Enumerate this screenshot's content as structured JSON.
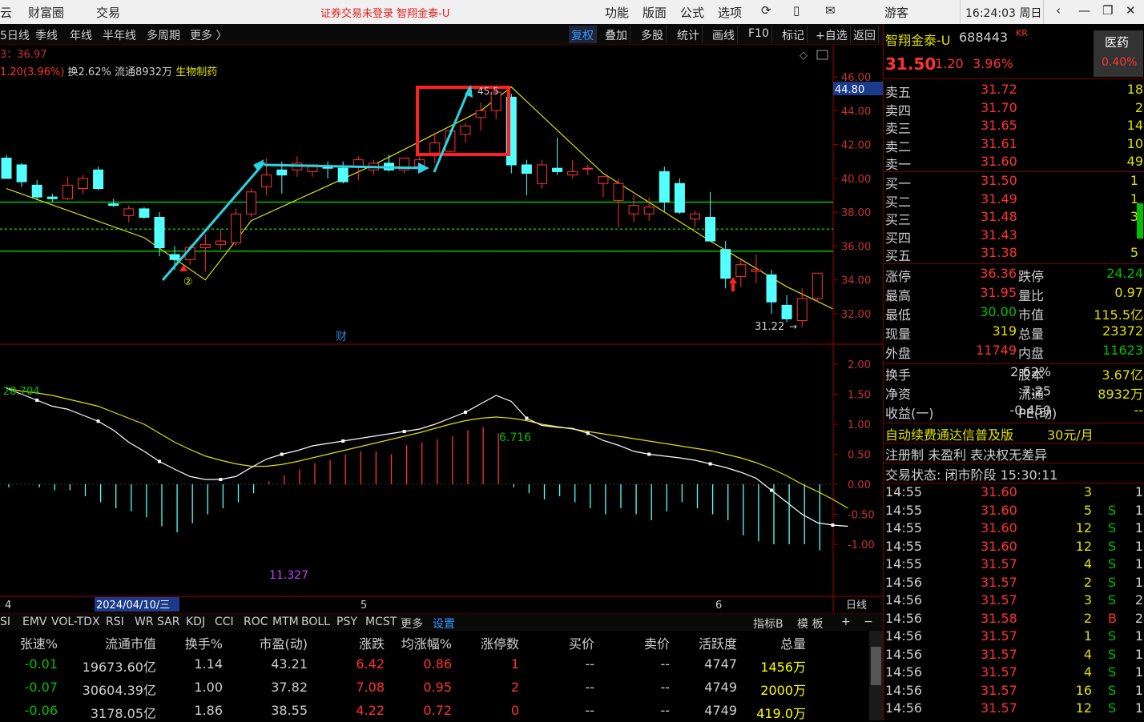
{
  "menu": {
    "items": [
      "云",
      "财富圈",
      "交易"
    ],
    "alert": "证券交易未登录  智翔金泰-U",
    "tools": [
      "功能",
      "版面",
      "公式",
      "选项"
    ],
    "user": "游客",
    "clock": "16:24:03 周日",
    "win": [
      "‹",
      "—",
      "❐",
      "✕"
    ]
  },
  "toolbar": {
    "periods": [
      "5日线",
      "季线",
      "年线",
      "半年线",
      "多周期",
      "更多 〉"
    ],
    "buttons": [
      "复权",
      "叠加",
      "多股",
      "统计",
      "画线",
      "F10",
      "标记",
      "+自选",
      "返回"
    ]
  },
  "info": {
    "line1": "3：36.97",
    "change": "1.20(3.96%)",
    "turnover": "换2.62% 流通8932万",
    "industry": "生物制药"
  },
  "chart_data": {
    "type": "candlestick",
    "price_axis": {
      "min": 32,
      "max": 46,
      "ticks": [
        "46.00",
        "44.00",
        "42.00",
        "40.00",
        "38.00",
        "36.00",
        "34.00",
        "32.00"
      ],
      "marker": "44.80"
    },
    "macd_axis": {
      "min": -1,
      "max": 2,
      "ticks": [
        "2.00",
        "1.50",
        "1.00",
        "0.50",
        "0.00",
        "-0.50",
        "-1.00"
      ]
    },
    "date_labels": [
      "4",
      "2024/04/10/三",
      "5",
      "6",
      "日线"
    ],
    "annotations": {
      "peak": "45.5",
      "low": "31.22",
      "circle": "②",
      "fin": "财",
      "macd_left": "28.704",
      "macd_mid": "6.716",
      "macd_bottom": "11.327"
    },
    "candles": [
      [
        41.2,
        41.4,
        40.2,
        40.0
      ],
      [
        40.8,
        40.9,
        39.5,
        39.8
      ],
      [
        39.6,
        39.9,
        38.7,
        38.9
      ],
      [
        38.9,
        39.1,
        38.6,
        38.8
      ],
      [
        38.8,
        40.1,
        38.7,
        39.6
      ],
      [
        39.4,
        40.2,
        39.1,
        40.0
      ],
      [
        40.5,
        40.7,
        39.3,
        39.4
      ],
      [
        38.5,
        38.8,
        38.3,
        38.4
      ],
      [
        37.8,
        38.4,
        37.4,
        38.2
      ],
      [
        38.2,
        38.3,
        37.6,
        37.7
      ],
      [
        37.7,
        38.0,
        35.4,
        35.9
      ],
      [
        35.5,
        36.0,
        34.6,
        35.2
      ],
      [
        35.2,
        36.1,
        34.9,
        35.9
      ],
      [
        35.9,
        36.7,
        34.5,
        36.1
      ],
      [
        36.1,
        37.0,
        35.8,
        36.3
      ],
      [
        36.2,
        38.2,
        36.0,
        37.9
      ],
      [
        37.9,
        39.4,
        37.7,
        39.2
      ],
      [
        39.5,
        41.2,
        39.0,
        40.2
      ],
      [
        40.5,
        41.0,
        39.1,
        40.2
      ],
      [
        40.5,
        41.3,
        40.1,
        40.9
      ],
      [
        40.4,
        40.8,
        40.1,
        40.8
      ],
      [
        40.7,
        41.0,
        40.0,
        40.6
      ],
      [
        40.6,
        41.0,
        39.7,
        39.8
      ],
      [
        40.7,
        41.3,
        39.9,
        41.1
      ],
      [
        40.5,
        41.1,
        40.2,
        40.9
      ],
      [
        40.9,
        41.4,
        40.4,
        40.5
      ],
      [
        40.5,
        41.2,
        40.3,
        41.2
      ],
      [
        40.7,
        41.3,
        40.5,
        41.1
      ],
      [
        41.5,
        42.7,
        40.9,
        42.1
      ],
      [
        41.6,
        42.9,
        41.5,
        42.8
      ],
      [
        42.6,
        43.3,
        42.1,
        43.1
      ],
      [
        43.6,
        44.5,
        42.8,
        44.0
      ],
      [
        44.0,
        45.5,
        43.5,
        45.1
      ],
      [
        44.8,
        45.0,
        40.3,
        40.8
      ],
      [
        40.8,
        41.1,
        39.0,
        40.3
      ],
      [
        39.7,
        41.1,
        39.4,
        40.8
      ],
      [
        40.6,
        42.4,
        40.2,
        40.4
      ],
      [
        40.2,
        41.1,
        40.0,
        40.4
      ],
      [
        40.6,
        40.8,
        40.2,
        40.6
      ],
      [
        39.7,
        40.1,
        38.9,
        40.1
      ],
      [
        38.7,
        40.0,
        37.1,
        39.7
      ],
      [
        37.9,
        39.0,
        37.4,
        38.4
      ],
      [
        37.9,
        38.9,
        37.5,
        38.3
      ],
      [
        40.4,
        40.7,
        38.0,
        38.6
      ],
      [
        39.7,
        40.0,
        37.9,
        38.0
      ],
      [
        37.6,
        38.1,
        37.1,
        37.9
      ],
      [
        37.7,
        39.2,
        36.3,
        36.3
      ],
      [
        35.8,
        36.3,
        33.5,
        34.1
      ],
      [
        34.2,
        35.2,
        33.6,
        34.9
      ],
      [
        34.5,
        35.5,
        33.8,
        34.6
      ],
      [
        34.3,
        34.6,
        32.0,
        32.7
      ],
      [
        32.5,
        33.1,
        31.5,
        31.7
      ],
      [
        31.6,
        33.5,
        31.2,
        32.9
      ],
      [
        32.9,
        34.4,
        32.7,
        34.4
      ],
      [
        34.1,
        34.5,
        33.3,
        33.8
      ]
    ],
    "ma_line": [
      [
        0,
        39.4
      ],
      [
        9,
        36.5
      ],
      [
        13,
        34.0
      ],
      [
        16,
        37.5
      ],
      [
        24,
        40.8
      ],
      [
        31,
        44.0
      ],
      [
        33,
        45.4
      ],
      [
        39,
        40.3
      ],
      [
        46,
        36.3
      ],
      [
        51,
        33.6
      ],
      [
        54,
        32.3
      ]
    ],
    "hlines": [
      38.6,
      37.0,
      35.7
    ],
    "macd_hist": [
      -0.05,
      0,
      -0.05,
      -0.1,
      -0.1,
      -0.2,
      -0.3,
      -0.4,
      -0.45,
      -0.55,
      -0.7,
      -0.8,
      -0.65,
      -0.5,
      -0.4,
      -0.3,
      -0.15,
      0.05,
      0.15,
      0.25,
      0.35,
      0.4,
      0.5,
      0.55,
      0.55,
      0.5,
      0.65,
      0.7,
      0.75,
      0.8,
      0.9,
      0.95,
      0.85,
      -0.05,
      -0.15,
      -0.25,
      -0.2,
      -0.3,
      -0.4,
      -0.5,
      -0.4,
      -0.5,
      -0.6,
      -0.45,
      -0.3,
      -0.4,
      -0.5,
      -0.6,
      -0.85,
      -0.95,
      -1.0,
      -1.0,
      -1.0,
      -1.1,
      -0.95
    ],
    "macd_dif": [
      1.6,
      1.5,
      1.4,
      1.3,
      1.25,
      1.15,
      1.05,
      0.9,
      0.7,
      0.55,
      0.38,
      0.25,
      0.13,
      0.08,
      0.08,
      0.13,
      0.28,
      0.42,
      0.5,
      0.56,
      0.64,
      0.68,
      0.72,
      0.76,
      0.8,
      0.84,
      0.88,
      0.92,
      1.0,
      1.1,
      1.2,
      1.34,
      1.48,
      1.38,
      1.1,
      0.98,
      0.95,
      0.93,
      0.85,
      0.73,
      0.65,
      0.55,
      0.5,
      0.47,
      0.44,
      0.4,
      0.34,
      0.28,
      0.2,
      0.1,
      -0.1,
      -0.3,
      -0.5,
      -0.64,
      -0.68,
      -0.7
    ],
    "macd_dea": [
      1.6,
      1.55,
      1.52,
      1.48,
      1.42,
      1.36,
      1.3,
      1.2,
      1.1,
      1.0,
      0.85,
      0.7,
      0.58,
      0.47,
      0.4,
      0.34,
      0.3,
      0.3,
      0.33,
      0.38,
      0.44,
      0.5,
      0.56,
      0.62,
      0.68,
      0.74,
      0.8,
      0.86,
      0.93,
      1.0,
      1.06,
      1.1,
      1.12,
      1.1,
      1.06,
      1.0,
      0.96,
      0.92,
      0.88,
      0.84,
      0.8,
      0.76,
      0.72,
      0.68,
      0.64,
      0.6,
      0.56,
      0.5,
      0.44,
      0.36,
      0.26,
      0.14,
      0.0,
      -0.12,
      -0.25,
      -0.4
    ]
  },
  "tabs": {
    "items": [
      "SI",
      "EMV",
      "VOL-TDX",
      "RSI",
      "WR",
      "SAR",
      "KDJ",
      "CCI",
      "ROC",
      "MTM",
      "BOLL",
      "PSY",
      "MCST",
      "更多",
      "设置"
    ],
    "right": [
      "指标B",
      "模 板",
      "+",
      "−"
    ]
  },
  "grid": {
    "headers": [
      "张速%",
      "流通市值",
      "换手%",
      "市盈(动)",
      "涨跌",
      "均涨幅%",
      "涨停数",
      "买价",
      "卖价",
      "活跃度",
      "总量"
    ],
    "rows": [
      [
        "-0.01",
        "19673.60亿",
        "1.14",
        "43.21",
        "6.42",
        "0.86",
        "1",
        "--",
        "--",
        "4747",
        "1456万"
      ],
      [
        "-0.07",
        "30604.39亿",
        "1.00",
        "37.82",
        "7.08",
        "0.95",
        "2",
        "--",
        "--",
        "4749",
        "2000万"
      ],
      [
        "-0.06",
        "3178.05亿",
        "1.86",
        "38.55",
        "4.22",
        "0.72",
        "0",
        "--",
        "--",
        "4749",
        "419.0万"
      ]
    ]
  },
  "quote": {
    "name": "智翔金泰-U",
    "code": "688443",
    "kr": "KR",
    "sector": "医药",
    "sector_pct": "0.40%",
    "price": "31.50",
    "chg": "1.20",
    "pct": "3.96%",
    "asks": [
      [
        "卖五",
        "31.72",
        "18"
      ],
      [
        "卖四",
        "31.70",
        "2"
      ],
      [
        "卖三",
        "31.65",
        "14"
      ],
      [
        "卖二",
        "31.61",
        "10"
      ],
      [
        "卖一",
        "31.60",
        "49"
      ]
    ],
    "bids": [
      [
        "买一",
        "31.50",
        "1"
      ],
      [
        "买二",
        "31.49",
        "1"
      ],
      [
        "买三",
        "31.48",
        "3"
      ],
      [
        "买四",
        "31.43",
        ""
      ],
      [
        "买五",
        "31.38",
        "5"
      ]
    ],
    "stats": [
      [
        "涨停",
        "36.36",
        "跌停",
        "24.24"
      ],
      [
        "最高",
        "31.95",
        "量比",
        "0.97"
      ],
      [
        "最低",
        "30.00",
        "市值",
        "115.5亿"
      ],
      [
        "现量",
        "319",
        "总量",
        "23372"
      ],
      [
        "外盘",
        "11749",
        "内盘",
        "11623"
      ]
    ],
    "stats2": [
      [
        "换手",
        "2.62%",
        "股本",
        "3.67亿"
      ],
      [
        "净资",
        "7.25",
        "流通",
        "8932万"
      ],
      [
        "收益(一)",
        "-0.450",
        "PE(动)",
        "--"
      ]
    ],
    "promo": {
      "text": "自动续费通达信普及版",
      "price": "30元/月"
    },
    "reg": "注册制 未盈利 表决权无差异",
    "state": "交易状态: 闭市阶段 15:30:11",
    "ticks": [
      [
        "14:55",
        "31.60",
        "3",
        "",
        "1"
      ],
      [
        "14:55",
        "31.60",
        "5",
        "S",
        "1"
      ],
      [
        "14:55",
        "31.60",
        "12",
        "S",
        "1"
      ],
      [
        "14:55",
        "31.60",
        "12",
        "S",
        "1"
      ],
      [
        "14:55",
        "31.57",
        "4",
        "S",
        "1"
      ],
      [
        "14:56",
        "31.57",
        "2",
        "S",
        "1"
      ],
      [
        "14:56",
        "31.57",
        "3",
        "S",
        "2"
      ],
      [
        "14:56",
        "31.58",
        "2",
        "B",
        "2"
      ],
      [
        "14:56",
        "31.57",
        "1",
        "S",
        "1"
      ],
      [
        "14:56",
        "31.57",
        "4",
        "S",
        "1"
      ],
      [
        "14:56",
        "31.57",
        "4",
        "S",
        "1"
      ],
      [
        "14:56",
        "31.57",
        "16",
        "S",
        "1"
      ],
      [
        "14:56",
        "31.57",
        "12",
        "S",
        "1"
      ]
    ]
  },
  "colors": {
    "up": "#ff3232",
    "down": "#54ffff",
    "ma": "#e0e000",
    "green": "#00c000",
    "red": "#ff3232",
    "yellow": "#ffff00",
    "purple": "#c040ff"
  }
}
